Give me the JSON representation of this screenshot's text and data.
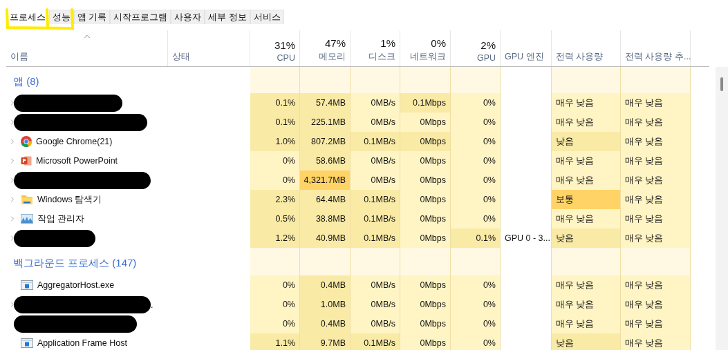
{
  "tabs": [
    {
      "label": "프로세스",
      "selected": true
    },
    {
      "label": "성능",
      "selected": false
    },
    {
      "label": "앱 기록",
      "selected": false
    },
    {
      "label": "시작프로그램",
      "selected": false
    },
    {
      "label": "사용자",
      "selected": false
    },
    {
      "label": "세부 정보",
      "selected": false
    },
    {
      "label": "서비스",
      "selected": false
    }
  ],
  "annotation": {
    "kind": "highlight"
  },
  "columns": [
    {
      "label": "이름",
      "sorted": true
    },
    {
      "label": "상태",
      "sorted": false
    },
    {
      "summary": "31%",
      "label": "CPU",
      "sorted": false
    },
    {
      "summary": "47%",
      "label": "메모리",
      "sorted": false
    },
    {
      "summary": "1%",
      "label": "디스크",
      "sorted": false
    },
    {
      "summary": "0%",
      "label": "네트워크",
      "sorted": false
    },
    {
      "summary": "2%",
      "label": "GPU",
      "sorted": false
    },
    {
      "label": "GPU 엔진",
      "sorted": false
    },
    {
      "label": "전력 사용량",
      "sorted": false
    },
    {
      "label": "전력 사용량 추...",
      "sorted": false
    }
  ],
  "groups": [
    {
      "title": "앱 (8)",
      "rows": [
        {
          "kind": "redacted",
          "expandable": true,
          "cells": [
            {
              "text": "0.1%",
              "color": "#f9eaa6"
            },
            {
              "text": "57.4MB",
              "color": "#f9eaa6"
            },
            {
              "text": "0MB/s",
              "color": "#fff4c4"
            },
            {
              "text": "0.1Mbps",
              "color": "#f9eaa6"
            },
            {
              "text": "0%",
              "color": "#fff4c4"
            },
            {},
            {
              "text": "매우 낮음",
              "color": "#fff4c4"
            },
            {
              "text": "매우 낮음",
              "color": "#fff4c4"
            }
          ]
        },
        {
          "kind": "redacted",
          "expandable": true,
          "cells": [
            {
              "text": "0.1%",
              "color": "#f9eaa6"
            },
            {
              "text": "225.1MB",
              "color": "#f9eaa6"
            },
            {
              "text": "0MB/s",
              "color": "#fff4c4"
            },
            {
              "text": "0Mbps",
              "color": "#fff4c4"
            },
            {
              "text": "0%",
              "color": "#fff4c4"
            },
            {},
            {
              "text": "매우 낮음",
              "color": "#fff4c4"
            },
            {
              "text": "매우 낮음",
              "color": "#fff4c4"
            }
          ]
        },
        {
          "kind": "browser",
          "name": "Google Chrome(21)",
          "expandable": true,
          "cells": [
            {
              "text": "1.0%",
              "color": "#f9eaa6"
            },
            {
              "text": "807.2MB",
              "color": "#f9eaa6"
            },
            {
              "text": "0.1MB/s",
              "color": "#f9eaa6"
            },
            {
              "text": "0Mbps",
              "color": "#f9eaa6"
            },
            {
              "text": "0%",
              "color": "#fff4c4"
            },
            {},
            {
              "text": "낮음",
              "color": "#f9eaa6"
            },
            {
              "text": "매우 낮음",
              "color": "#fff4c4"
            }
          ]
        },
        {
          "kind": "presentation",
          "name": "Microsoft PowerPoint",
          "expandable": true,
          "cells": [
            {
              "text": "0%",
              "color": "#fff4c4"
            },
            {
              "text": "58.6MB",
              "color": "#f9eaa6"
            },
            {
              "text": "0MB/s",
              "color": "#fff4c4"
            },
            {
              "text": "0Mbps",
              "color": "#fff4c4"
            },
            {
              "text": "0%",
              "color": "#fff4c4"
            },
            {},
            {
              "text": "매우 낮음",
              "color": "#fff4c4"
            },
            {
              "text": "매우 낮음",
              "color": "#fff4c4"
            }
          ]
        },
        {
          "kind": "redacted",
          "expandable": true,
          "cells": [
            {
              "text": "0%",
              "color": "#fff4c4"
            },
            {
              "text": "4,321.7MB",
              "color": "#ffd366"
            },
            {
              "text": "0MB/s",
              "color": "#fff4c4"
            },
            {
              "text": "0Mbps",
              "color": "#fff4c4"
            },
            {
              "text": "0%",
              "color": "#fff4c4"
            },
            {},
            {
              "text": "매우 낮음",
              "color": "#fff4c4"
            },
            {
              "text": "매우 낮음",
              "color": "#fff4c4"
            }
          ]
        },
        {
          "kind": "folder",
          "name": "Windows 탐색기",
          "expandable": true,
          "cells": [
            {
              "text": "2.3%",
              "color": "#f9eaa6"
            },
            {
              "text": "64.4MB",
              "color": "#f9eaa6"
            },
            {
              "text": "0.1MB/s",
              "color": "#f9eaa6"
            },
            {
              "text": "0Mbps",
              "color": "#fff4c4"
            },
            {
              "text": "0%",
              "color": "#fff4c4"
            },
            {},
            {
              "text": "보통",
              "color": "#ffd366"
            },
            {
              "text": "매우 낮음",
              "color": "#fff4c4"
            }
          ]
        },
        {
          "kind": "monitor",
          "name": "작업 관리자",
          "expandable": true,
          "cells": [
            {
              "text": "0.5%",
              "color": "#f9eaa6"
            },
            {
              "text": "38.8MB",
              "color": "#f9eaa6"
            },
            {
              "text": "0.1MB/s",
              "color": "#f9eaa6"
            },
            {
              "text": "0Mbps",
              "color": "#fff4c4"
            },
            {
              "text": "0%",
              "color": "#fff4c4"
            },
            {},
            {
              "text": "매우 낮음",
              "color": "#fff4c4"
            },
            {
              "text": "매우 낮음",
              "color": "#fff4c4"
            }
          ]
        },
        {
          "kind": "redacted",
          "expandable": true,
          "cells": [
            {
              "text": "1.2%",
              "color": "#f9eaa6"
            },
            {
              "text": "40.9MB",
              "color": "#f9eaa6"
            },
            {
              "text": "0.1MB/s",
              "color": "#f9eaa6"
            },
            {
              "text": "0Mbps",
              "color": "#fff4c4"
            },
            {
              "text": "0.1%",
              "color": "#f9eaa6"
            },
            {
              "text": "GPU 0 - 3..."
            },
            {
              "text": "낮음",
              "color": "#f9eaa6"
            },
            {
              "text": "매우 낮음",
              "color": "#fff4c4"
            }
          ]
        }
      ]
    },
    {
      "title": "백그라운드 프로세스 (147)",
      "rows": [
        {
          "kind": "process",
          "name": "AggregatorHost.exe",
          "expandable": false,
          "cells": [
            {
              "text": "0%",
              "color": "#fff4c4"
            },
            {
              "text": "0.4MB",
              "color": "#f9eaa6"
            },
            {
              "text": "0MB/s",
              "color": "#fff4c4"
            },
            {
              "text": "0Mbps",
              "color": "#fff4c4"
            },
            {
              "text": "0%",
              "color": "#fff4c4"
            },
            {},
            {
              "text": "매우 낮음",
              "color": "#fff4c4"
            },
            {
              "text": "매우 낮음",
              "color": "#fff4c4"
            }
          ]
        },
        {
          "kind": "redacted",
          "name": ".",
          "expandable": true,
          "cells": [
            {
              "text": "0%",
              "color": "#fff4c4"
            },
            {
              "text": "1.0MB",
              "color": "#f9eaa6"
            },
            {
              "text": "0MB/s",
              "color": "#fff4c4"
            },
            {
              "text": "0Mbps",
              "color": "#fff4c4"
            },
            {
              "text": "0%",
              "color": "#fff4c4"
            },
            {},
            {
              "text": "매우 낮음",
              "color": "#fff4c4"
            },
            {
              "text": "매우 낮음",
              "color": "#fff4c4"
            }
          ]
        },
        {
          "kind": "redacted",
          "expandable": false,
          "cells": [
            {
              "text": "0%",
              "color": "#fff4c4"
            },
            {
              "text": "0.4MB",
              "color": "#f9eaa6"
            },
            {
              "text": "0MB/s",
              "color": "#fff4c4"
            },
            {
              "text": "0Mbps",
              "color": "#fff4c4"
            },
            {
              "text": "0%",
              "color": "#fff4c4"
            },
            {},
            {
              "text": "매우 낮음",
              "color": "#fff4c4"
            },
            {
              "text": "매우 낮음",
              "color": "#fff4c4"
            }
          ]
        },
        {
          "kind": "process",
          "name": "Application Frame Host",
          "expandable": false,
          "cells": [
            {
              "text": "1.1%",
              "color": "#f9eaa6"
            },
            {
              "text": "9.7MB",
              "color": "#f9eaa6"
            },
            {
              "text": "0.1MB/s",
              "color": "#f9eaa6"
            },
            {
              "text": "0Mbps",
              "color": "#fff4c4"
            },
            {
              "text": "0%",
              "color": "#fff4c4"
            },
            {},
            {
              "text": "낮음",
              "color": "#f9eaa6"
            },
            {
              "text": "매우 낮음",
              "color": "#fff4c4"
            }
          ]
        }
      ]
    }
  ]
}
